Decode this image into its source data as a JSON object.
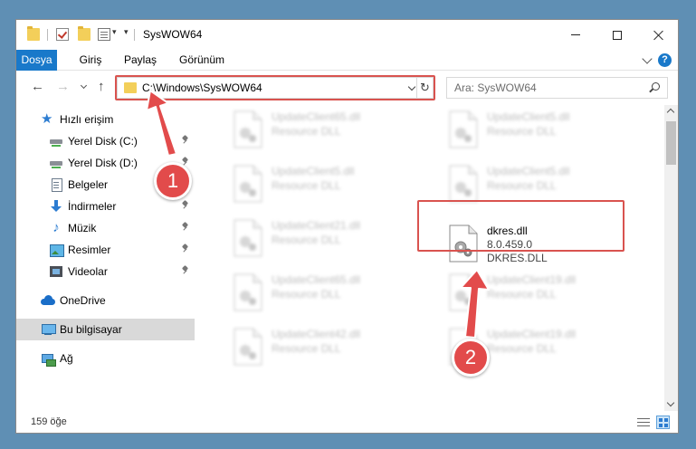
{
  "window": {
    "title": "SysWOW64",
    "minimize_label": "",
    "maximize_label": "",
    "close_label": ""
  },
  "ribbon": {
    "tabs": [
      "Dosya",
      "Giriş",
      "Paylaş",
      "Görünüm"
    ],
    "active_tab": "Dosya",
    "help_label": "?"
  },
  "nav": {
    "back_glyph": "←",
    "forward_glyph": "→",
    "up_glyph": "↑",
    "refresh_glyph": "↻"
  },
  "address": {
    "path": "C:\\Windows\\SysWOW64"
  },
  "search": {
    "placeholder": "Ara: SysWOW64"
  },
  "sidebar": {
    "items": [
      {
        "label": "Hızlı erişim",
        "icon": "star-icon",
        "pinned": false
      },
      {
        "label": "Yerel Disk (C:)",
        "icon": "disk-icon",
        "pinned": true
      },
      {
        "label": "Yerel Disk (D:)",
        "icon": "disk-icon",
        "pinned": true
      },
      {
        "label": "Belgeler",
        "icon": "document-icon",
        "pinned": true
      },
      {
        "label": "İndirmeler",
        "icon": "download-icon",
        "pinned": true
      },
      {
        "label": "Müzik",
        "icon": "music-icon",
        "pinned": true
      },
      {
        "label": "Resimler",
        "icon": "picture-icon",
        "pinned": true
      },
      {
        "label": "Videolar",
        "icon": "video-icon",
        "pinned": true
      },
      {
        "label": "OneDrive",
        "icon": "cloud-icon",
        "pinned": false
      },
      {
        "label": "Bu bilgisayar",
        "icon": "computer-icon",
        "pinned": false,
        "selected": true
      },
      {
        "label": "Ağ",
        "icon": "network-icon",
        "pinned": false
      }
    ]
  },
  "files": [
    {
      "name": "UpdateClient65.dll",
      "type": "Resource DLL"
    },
    {
      "name": "UpdateClient5.dll",
      "type": "Resource DLL"
    },
    {
      "name": "UpdateClient5.dll",
      "type": "Resource DLL"
    },
    {
      "name": "UpdateClient5.dll",
      "type": "Resource DLL"
    },
    {
      "name": "UpdateClient21.dll",
      "type": "Resource DLL"
    },
    {
      "name": "dkres.dll",
      "version": "8.0.459.0",
      "type": "DKRES.DLL",
      "highlighted": true
    },
    {
      "name": "UpdateClient65.dll",
      "type": "Resource DLL"
    },
    {
      "name": "UpdateClient19.dll",
      "type": "Resource DLL"
    },
    {
      "name": "UpdateClient42.dll",
      "type": "Resource DLL"
    },
    {
      "name": "UpdateClient19.dll",
      "type": "Resource DLL"
    }
  ],
  "status": {
    "item_count": "159 öğe"
  },
  "callouts": [
    "1",
    "2"
  ],
  "colors": {
    "accent": "#1979ca",
    "highlight": "#d9534f",
    "callout": "#e24b4b",
    "selected_nav": "#d9d9d9"
  }
}
